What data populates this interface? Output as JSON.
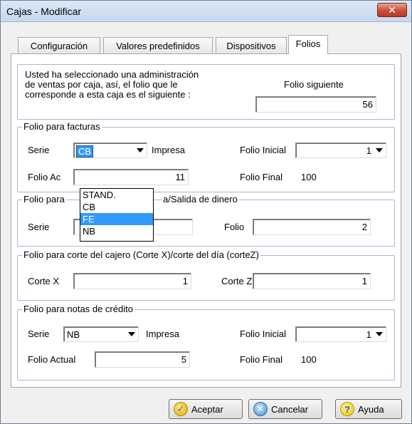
{
  "window": {
    "title": "Cajas - Modificar",
    "close_symbol": "✕"
  },
  "tabs": [
    {
      "label": "Configuración",
      "active": false
    },
    {
      "label": "Valores predefinidos",
      "active": false
    },
    {
      "label": "Dispositivos",
      "active": false
    },
    {
      "label": "Folios",
      "active": true
    }
  ],
  "info": {
    "text_line1": "Usted ha seleccionado una administración",
    "text_line2": "de ventas por caja, así, el folio que le",
    "text_line3": "corresponde a esta caja es el siguiente :",
    "folio_siguiente_label": "Folio siguiente",
    "folio_siguiente_value": "56"
  },
  "facturas": {
    "title": "Folio para facturas",
    "serie_label": "Serie",
    "serie_value": "CB",
    "impresa_label": "Impresa",
    "folio_inicial_label": "Folio Inicial",
    "folio_inicial_value": "1",
    "folio_actual_label": "Folio Ac",
    "folio_actual_value": "11",
    "folio_final_label": "Folio Final",
    "folio_final_value": "100",
    "dropdown_options": [
      "STAND.",
      "CB",
      "FE",
      "NB"
    ],
    "dropdown_highlighted": "FE"
  },
  "dinero": {
    "title_left": "Folio para",
    "title_right": "a/Salida de dinero",
    "serie_label": "Serie",
    "serie_value": "",
    "folio_label": "Folio",
    "folio_value": "2"
  },
  "corte": {
    "title": "Folio para  corte del cajero (Corte X)/corte del día (corteZ)",
    "corte_x_label": "Corte X",
    "corte_x_value": "1",
    "corte_z_label": "Corte Z",
    "corte_z_value": "1"
  },
  "credito": {
    "title": "Folio para notas de crédito",
    "serie_label": "Serie",
    "serie_value": "NB",
    "impresa_label": "Impresa",
    "folio_inicial_label": "Folio Inicial",
    "folio_inicial_value": "1",
    "folio_actual_label": "Folio Actual",
    "folio_actual_value": "5",
    "folio_final_label": "Folio Final",
    "folio_final_value": "100"
  },
  "buttons": {
    "accept": "Aceptar",
    "cancel": "Cancelar",
    "help": "Ayuda"
  },
  "icons": {
    "close": "close-icon",
    "accept": "checkmark-icon",
    "cancel": "cancel-x-icon",
    "help": "question-icon"
  }
}
